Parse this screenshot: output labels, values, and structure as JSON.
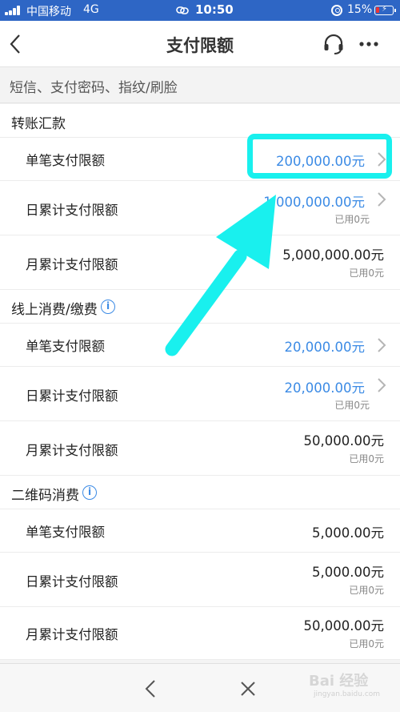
{
  "status_bar": {
    "carrier": "中国移动",
    "network": "4G",
    "time": "10:50",
    "battery_pct": "15%",
    "icons": [
      "signal-icon",
      "link-icon",
      "orientation-lock-icon",
      "battery-charging-icon"
    ]
  },
  "nav": {
    "title": "支付限额",
    "icons": [
      "back-chevron-icon",
      "headset-icon",
      "more-icon"
    ]
  },
  "subtitle": "短信、支付密码、指纹/刷脸",
  "sections": [
    {
      "title": "转账汇款",
      "rows": [
        {
          "label": "单笔支付限额",
          "amount": "200,000.00元",
          "used": "",
          "editable": true
        },
        {
          "label": "日累计支付限额",
          "amount": "1,000,000.00元",
          "used": "已用0元",
          "editable": true
        },
        {
          "label": "月累计支付限额",
          "amount": "5,000,000.00元",
          "used": "已用0元",
          "editable": false
        }
      ]
    },
    {
      "title": "线上消费/缴费",
      "info_icon": "i",
      "rows": [
        {
          "label": "单笔支付限额",
          "amount": "20,000.00元",
          "used": "",
          "editable": true
        },
        {
          "label": "日累计支付限额",
          "amount": "20,000.00元",
          "used": "已用0元",
          "editable": true
        },
        {
          "label": "月累计支付限额",
          "amount": "50,000.00元",
          "used": "已用0元",
          "editable": false
        }
      ]
    },
    {
      "title": "二维码消费",
      "info_icon": "i",
      "rows": [
        {
          "label": "单笔支付限额",
          "amount": "5,000.00元",
          "used": "",
          "editable": false
        },
        {
          "label": "日累计支付限额",
          "amount": "5,000.00元",
          "used": "已用0元",
          "editable": false
        },
        {
          "label": "月累计支付限额",
          "amount": "50,000.00元",
          "used": "已用0元",
          "editable": false
        }
      ]
    }
  ],
  "bottom_bar": {
    "icons": [
      "back-icon",
      "close-icon"
    ]
  },
  "watermark": {
    "text": "Bai 经验",
    "sub": "jingyan.baidu.com"
  },
  "colors": {
    "accent": "#3c8be5",
    "status_bar": "#2e66c5",
    "highlight": "#19f0ee"
  }
}
